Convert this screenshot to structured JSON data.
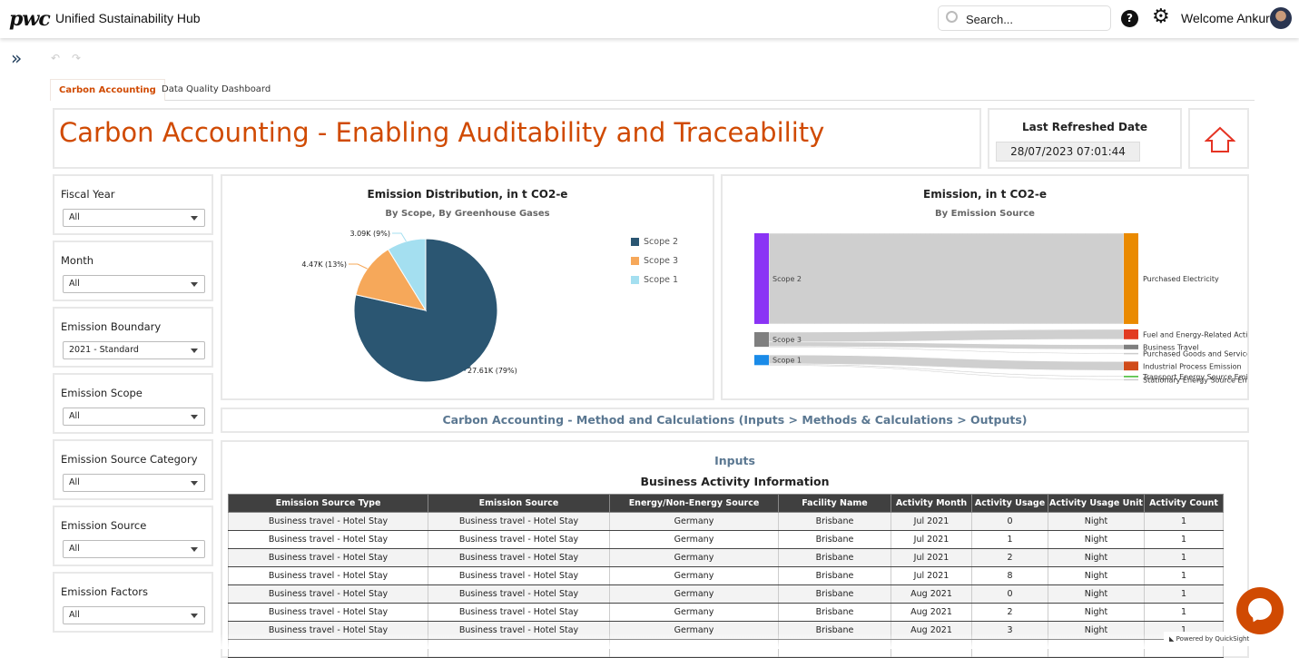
{
  "header": {
    "logo": "pwc",
    "app_title": "Unified Sustainability Hub",
    "search_placeholder": "Search...",
    "help": "?",
    "welcome": "Welcome Ankur"
  },
  "toolbar": {
    "expand": "»",
    "undo": "↶",
    "redo": "↷"
  },
  "tabs": [
    {
      "label": "Carbon Accounting",
      "active": true
    },
    {
      "label": "Data Quality Dashboard",
      "active": false
    }
  ],
  "page_title": "Carbon Accounting - Enabling Auditability and Traceability",
  "last_refreshed": {
    "label": "Last Refreshed Date",
    "value": "28/07/2023 07:01:44"
  },
  "filters": [
    {
      "label": "Fiscal Year",
      "value": "All"
    },
    {
      "label": "Month",
      "value": "All"
    },
    {
      "label": "Emission Boundary",
      "value": "2021 - Standard"
    },
    {
      "label": "Emission Scope",
      "value": "All"
    },
    {
      "label": "Emission Source Category",
      "value": "All"
    },
    {
      "label": "Emission Source",
      "value": "All"
    },
    {
      "label": "Emission Factors",
      "value": "All"
    }
  ],
  "chart_data": [
    {
      "type": "pie",
      "title": "Emission Distribution, in t CO2-e",
      "subtitle": "By Scope, By Greenhouse Gases",
      "legend_position": "right",
      "slices": [
        {
          "name": "Scope 2",
          "value": 27.61,
          "label": "27.61K (79%)",
          "color": "#2b5672"
        },
        {
          "name": "Scope 3",
          "value": 4.47,
          "label": "4.47K (13%)",
          "color": "#f6a85a"
        },
        {
          "name": "Scope 1",
          "value": 3.09,
          "label": "3.09K (9%)",
          "color": "#a4dff0"
        }
      ]
    },
    {
      "type": "sankey",
      "title": "Emission, in t CO2-e",
      "subtitle": "By  Emission Source",
      "sources": [
        {
          "name": "Scope 2",
          "color": "#8a33f5"
        },
        {
          "name": "Scope 3",
          "color": "#7f7f7f"
        },
        {
          "name": "Scope 1",
          "color": "#1a8be8"
        }
      ],
      "targets": [
        {
          "name": "Purchased Electricity",
          "color": "#ea8a00"
        },
        {
          "name": "Fuel and Energy-Related Acti",
          "color": "#e23b22"
        },
        {
          "name": "Business Travel",
          "color": "#7f7f7f"
        },
        {
          "name": "Purchased Goods and Service",
          "color": "#cccccc"
        },
        {
          "name": "Industrial Process Emission",
          "color": "#d04a18"
        },
        {
          "name": "Transport Energy Source Emi",
          "color": "#3cb82c"
        },
        {
          "name": "Stationary Energy Source Em",
          "color": "#cccccc"
        }
      ],
      "links": [
        {
          "source": "Scope 2",
          "target": "Purchased Electricity",
          "value": 27.61
        },
        {
          "source": "Scope 3",
          "target": "Fuel and Energy-Related Acti",
          "value": 3.0
        },
        {
          "source": "Scope 3",
          "target": "Business Travel",
          "value": 1.4
        },
        {
          "source": "Scope 3",
          "target": "Purchased Goods and Service",
          "value": 0.07
        },
        {
          "source": "Scope 1",
          "target": "Industrial Process Emission",
          "value": 2.7
        },
        {
          "source": "Scope 1",
          "target": "Transport Energy Source Emi",
          "value": 0.3
        },
        {
          "source": "Scope 1",
          "target": "Stationary Energy Source Em",
          "value": 0.09
        }
      ]
    }
  ],
  "method_banner": "Carbon Accounting - Method and Calculations (Inputs > Methods & Calculations > Outputs)",
  "inputs": {
    "heading": "Inputs",
    "table_title": "Business Activity Information",
    "columns": [
      "Emission Source Type",
      "Emission Source",
      "Energy/Non-Energy Source",
      "Facility Name",
      "Activity Month",
      "Activity Usage",
      "Activity Usage Unit",
      "Activity Count"
    ],
    "rows": [
      [
        "Business travel - Hotel Stay",
        "Business travel - Hotel Stay",
        "Germany",
        "Brisbane",
        "Jul 2021",
        "0",
        "Night",
        "1"
      ],
      [
        "Business travel - Hotel Stay",
        "Business travel - Hotel Stay",
        "Germany",
        "Brisbane",
        "Jul 2021",
        "1",
        "Night",
        "1"
      ],
      [
        "Business travel - Hotel Stay",
        "Business travel - Hotel Stay",
        "Germany",
        "Brisbane",
        "Jul 2021",
        "2",
        "Night",
        "1"
      ],
      [
        "Business travel - Hotel Stay",
        "Business travel - Hotel Stay",
        "Germany",
        "Brisbane",
        "Jul 2021",
        "8",
        "Night",
        "1"
      ],
      [
        "Business travel - Hotel Stay",
        "Business travel - Hotel Stay",
        "Germany",
        "Brisbane",
        "Aug 2021",
        "0",
        "Night",
        "1"
      ],
      [
        "Business travel - Hotel Stay",
        "Business travel - Hotel Stay",
        "Germany",
        "Brisbane",
        "Aug 2021",
        "2",
        "Night",
        "1"
      ],
      [
        "Business travel - Hotel Stay",
        "Business travel - Hotel Stay",
        "Germany",
        "Brisbane",
        "Aug 2021",
        "3",
        "Night",
        "1"
      ]
    ]
  },
  "footer": {
    "powered_by": "Powered by QuickSight"
  }
}
